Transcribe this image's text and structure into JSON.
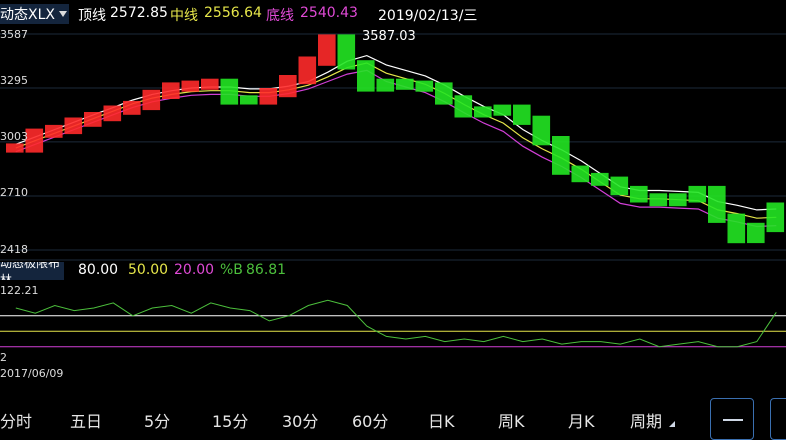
{
  "header": {
    "indicator": "动态XLX",
    "top_label": "顶线",
    "top_value": "2572.85",
    "mid_label": "中线",
    "mid_value": "2556.64",
    "bot_label": "底线",
    "bot_value": "2540.43",
    "date": "2019/02/13/三"
  },
  "price_axis": [
    "3587",
    "3295",
    "3003",
    "2710",
    "2418"
  ],
  "peak_label": "3587.03",
  "sub_header": {
    "indicator": "动态极限布林",
    "v1": "80.00",
    "v2": "50.00",
    "v3": "20.00",
    "pb_label": "%B",
    "pb_value": "86.81"
  },
  "sub_axis": {
    "top": "122.21",
    "bottom": "2",
    "start_date": "2017/06/09"
  },
  "tabs": [
    "分时",
    "五日",
    "5分",
    "15分",
    "30分",
    "60分",
    "日K",
    "周K",
    "月K",
    "周期"
  ],
  "colors": {
    "up": "#ff2a2a",
    "down": "#22e622",
    "top": "#ffffff",
    "mid": "#e6e64a",
    "bot": "#d13fd6",
    "osc": "#4cbf3c"
  },
  "chart_data": [
    {
      "type": "line",
      "title": "",
      "x_start": "2017/06/09",
      "x_end": "2019/02/13",
      "ylim": [
        2418,
        3587
      ],
      "y_ticks": [
        3587,
        3295,
        3003,
        2710,
        2418
      ],
      "series": [
        {
          "name": "顶线",
          "color": "#ffffff",
          "values": [
            2990,
            3030,
            3070,
            3110,
            3150,
            3190,
            3230,
            3260,
            3280,
            3295,
            3300,
            3300,
            3290,
            3290,
            3305,
            3330,
            3380,
            3440,
            3470,
            3420,
            3390,
            3360,
            3310,
            3250,
            3195,
            3150,
            3070,
            3010,
            2960,
            2900,
            2830,
            2760,
            2740,
            2740,
            2735,
            2730,
            2680,
            2660,
            2635,
            2640
          ]
        },
        {
          "name": "中线",
          "color": "#e6e64a",
          "values": [
            2970,
            3010,
            3050,
            3090,
            3130,
            3170,
            3210,
            3240,
            3260,
            3275,
            3280,
            3280,
            3270,
            3270,
            3285,
            3310,
            3355,
            3405,
            3430,
            3375,
            3345,
            3315,
            3265,
            3205,
            3150,
            3105,
            3025,
            2965,
            2915,
            2855,
            2785,
            2715,
            2695,
            2695,
            2690,
            2685,
            2635,
            2615,
            2590,
            2595
          ]
        },
        {
          "name": "底线",
          "color": "#d13fd6",
          "values": [
            2950,
            2990,
            3030,
            3070,
            3110,
            3150,
            3190,
            3220,
            3240,
            3255,
            3260,
            3260,
            3250,
            3250,
            3265,
            3290,
            3330,
            3370,
            3390,
            3330,
            3300,
            3270,
            3220,
            3160,
            3105,
            3060,
            2980,
            2920,
            2870,
            2810,
            2740,
            2670,
            2650,
            2650,
            2645,
            2640,
            2590,
            2570,
            2545,
            2550
          ]
        },
        {
          "name": "price",
          "values": [
            2970,
            3050,
            3070,
            3110,
            3140,
            3175,
            3200,
            3260,
            3300,
            3310,
            3320,
            3230,
            3230,
            3270,
            3340,
            3440,
            3560,
            3420,
            3300,
            3320,
            3310,
            3300,
            3230,
            3160,
            3170,
            3180,
            3120,
            3010,
            2850,
            2810,
            2790,
            2740,
            2700,
            2680,
            2700,
            2740,
            2590,
            2480,
            2540,
            2650
          ],
          "up": [
            1,
            1,
            1,
            1,
            1,
            1,
            1,
            1,
            1,
            1,
            1,
            0,
            0,
            1,
            1,
            1,
            1,
            0,
            0,
            0,
            0,
            0,
            0,
            0,
            0,
            0,
            0,
            0,
            0,
            0,
            0,
            0,
            0,
            0,
            0,
            0,
            0,
            0,
            0,
            0
          ]
        }
      ]
    },
    {
      "type": "line",
      "title": "",
      "ylim": [
        2,
        122.21
      ],
      "levels": [
        {
          "name": "80.00",
          "value": 80,
          "color": "#ffffff"
        },
        {
          "name": "50.00",
          "value": 50,
          "color": "#e6e64a"
        },
        {
          "name": "20.00",
          "value": 20,
          "color": "#d13fd6"
        }
      ],
      "series": [
        {
          "name": "%B",
          "color": "#4cbf3c",
          "values": [
            95,
            85,
            100,
            90,
            95,
            105,
            80,
            95,
            100,
            85,
            105,
            95,
            90,
            70,
            80,
            100,
            110,
            100,
            60,
            40,
            35,
            40,
            30,
            35,
            30,
            40,
            30,
            35,
            25,
            30,
            30,
            25,
            35,
            20,
            25,
            30,
            20,
            20,
            30,
            86.81
          ]
        }
      ]
    }
  ]
}
